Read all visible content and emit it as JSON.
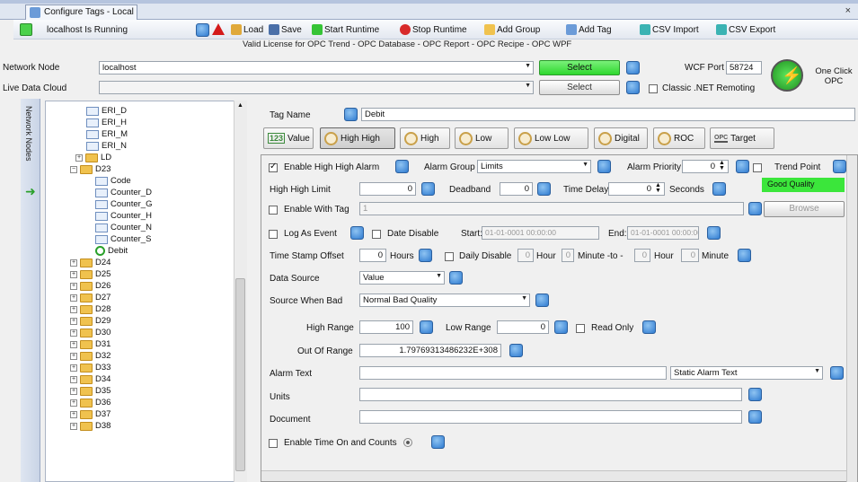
{
  "window": {
    "tab_title": "Configure Tags - Local",
    "close": "×"
  },
  "toolbar": {
    "status": "localhost Is Running",
    "load": "Load",
    "save": "Save",
    "start_runtime": "Start Runtime",
    "stop_runtime": "Stop Runtime",
    "add_group": "Add Group",
    "add_tag": "Add Tag",
    "csv_import": "CSV Import",
    "csv_export": "CSV Export"
  },
  "license_text": "Valid License for OPC Trend - OPC Database - OPC Report - OPC Recipe - OPC WPF",
  "network": {
    "network_node_label": "Network Node",
    "network_node_value": "localhost",
    "select_label": "Select",
    "live_data_cloud_label": "Live Data Cloud",
    "live_select_label": "Select",
    "wcf_port_label": "WCF Port",
    "wcf_port_value": "58724",
    "classic_label": "Classic .NET Remoting",
    "one_click_label": "One Click OPC"
  },
  "sidebar": {
    "label": "Network Nodes"
  },
  "tree": {
    "items": [
      "ERI_D",
      "ERI_H",
      "ERI_M",
      "ERI_N",
      "LD",
      "D23",
      "Code",
      "Counter_D",
      "Counter_G",
      "Counter_H",
      "Counter_N",
      "Counter_S",
      "Debit",
      "D24",
      "D25",
      "D26",
      "D27",
      "D28",
      "D29",
      "D30",
      "D31",
      "D32",
      "D33",
      "D34",
      "D35",
      "D36",
      "D37",
      "D38"
    ]
  },
  "tag": {
    "name_label": "Tag Name",
    "name_value": "Debit"
  },
  "tabs": [
    "Value",
    "High High",
    "High",
    "Low",
    "Low Low",
    "Digital",
    "ROC",
    "Target"
  ],
  "tabs_icon_text": {
    "value": "123",
    "target": "OPC"
  },
  "form": {
    "enable_hh_alarm": "Enable High High Alarm",
    "alarm_group_label": "Alarm Group",
    "alarm_group_value": "Limits",
    "alarm_priority_label": "Alarm Priority",
    "alarm_priority_value": "0",
    "trend_point": "Trend Point",
    "hh_limit_label": "High High Limit",
    "hh_limit_value": "0",
    "deadband_label": "Deadband",
    "deadband_value": "0",
    "time_delay_label": "Time Delay",
    "time_delay_value": "0",
    "seconds_label": "Seconds",
    "quality_text": "Good Quality",
    "enable_with_tag": "Enable With Tag",
    "enable_with_tag_value": "1",
    "browse_label": "Browse",
    "log_as_event": "Log As Event",
    "date_disable": "Date Disable",
    "start_label": "Start:",
    "start_value": "01-01-0001 00:00:00",
    "end_label": "End:",
    "end_value": "01-01-0001 00:00:00",
    "ts_offset_label": "Time Stamp Offset",
    "ts_offset_value": "0",
    "hours_label": "Hours",
    "daily_disable": "Daily Disable",
    "dd_hour1": "0",
    "hour_label": "Hour",
    "dd_min1": "0",
    "minute_to_label": "Minute -to -",
    "dd_hour2": "0",
    "hour2_label": "Hour",
    "dd_min2": "0",
    "minute_label": "Minute",
    "data_source_label": "Data Source",
    "data_source_value": "Value",
    "source_bad_label": "Source When Bad",
    "source_bad_value": "Normal Bad Quality",
    "high_range_label": "High Range",
    "high_range_value": "100",
    "low_range_label": "Low Range",
    "low_range_value": "0",
    "read_only": "Read Only",
    "out_of_range_label": "Out Of Range",
    "out_of_range_value": "1.79769313486232E+308",
    "alarm_text_label": "Alarm Text",
    "alarm_text_value": "",
    "alarm_text_mode": "Static Alarm Text",
    "units_label": "Units",
    "units_value": "",
    "document_label": "Document",
    "document_value": "",
    "enable_time_on": "Enable Time On and Counts"
  },
  "colors": {
    "accent": "#2e7ad0",
    "quality": "#3be63b",
    "select_btn": "#36e036"
  }
}
